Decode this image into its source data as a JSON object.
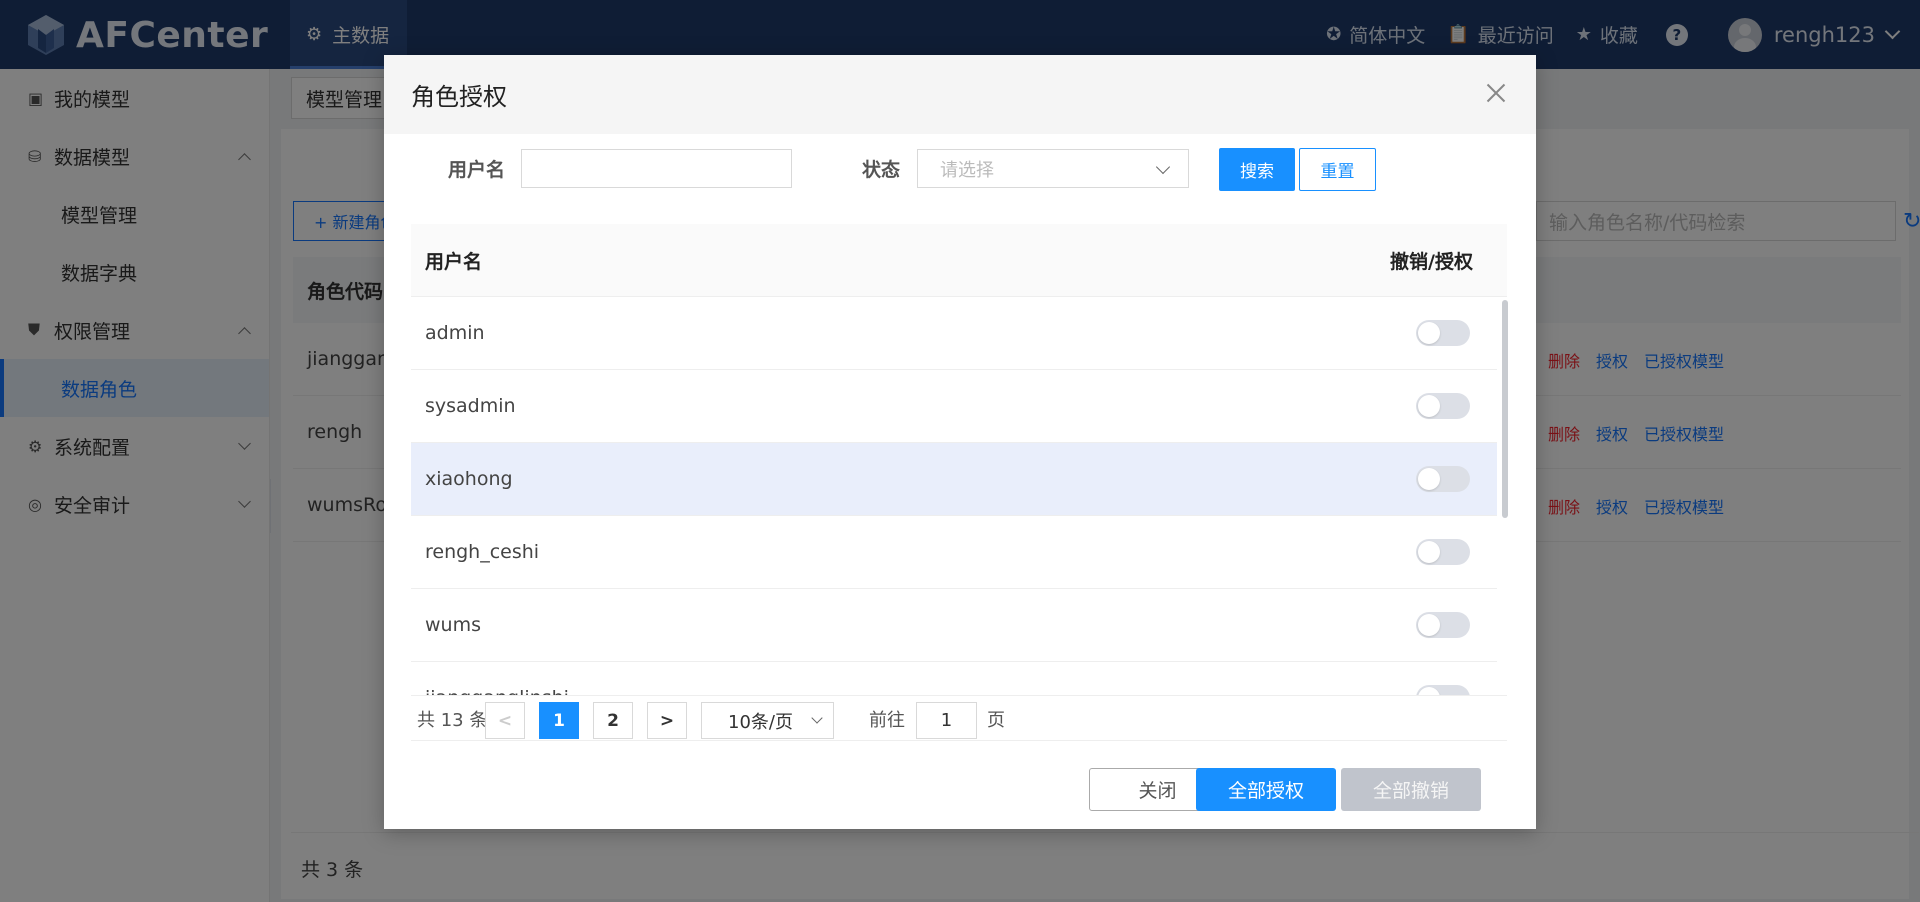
{
  "header": {
    "logo_text": "AFCenter",
    "nav_label": "主数据",
    "lang_label": "简体中文",
    "recent_label": "最近访问",
    "favorite_label": "收藏",
    "help_label": "?",
    "username": "rengh123"
  },
  "sidebar": {
    "items": [
      {
        "label": "我的模型"
      },
      {
        "label": "数据模型"
      },
      {
        "label": "模型管理"
      },
      {
        "label": "数据字典"
      },
      {
        "label": "权限管理"
      },
      {
        "label": "数据角色"
      },
      {
        "label": "系统配置"
      },
      {
        "label": "安全审计"
      }
    ]
  },
  "background": {
    "tab_label": "模型管理",
    "new_button": "+ 新建角色",
    "search_placeholder": "输入角色名称/代码检索",
    "column_role_code": "角色代码",
    "rows": [
      {
        "code": "jianggangl"
      },
      {
        "code": "rengh"
      },
      {
        "code": "wumsRole"
      }
    ],
    "actions": {
      "delete": "删除",
      "grant": "授权",
      "granted_models": "已授权模型"
    },
    "total": "共 3 条"
  },
  "modal": {
    "title": "角色授权",
    "filter": {
      "username_label": "用户名",
      "username_value": "",
      "status_label": "状态",
      "status_placeholder": "请选择",
      "search_button": "搜索",
      "reset_button": "重置"
    },
    "table": {
      "col_username": "用户名",
      "col_action": "撤销/授权",
      "rows": [
        {
          "username": "admin",
          "granted": false
        },
        {
          "username": "sysadmin",
          "granted": false
        },
        {
          "username": "xiaohong",
          "granted": false
        },
        {
          "username": "rengh_ceshi",
          "granted": false
        },
        {
          "username": "wums",
          "granted": false
        },
        {
          "username": "jiangganglinshi",
          "granted": false
        }
      ]
    },
    "pagination": {
      "total": "共 13 条",
      "prev": "<",
      "page1": "1",
      "page2": "2",
      "next": ">",
      "page_size": "10条/页",
      "goto_label": "前往",
      "goto_value": "1",
      "page_label": "页"
    },
    "footer": {
      "close": "关闭",
      "grant_all": "全部授权",
      "revoke_all": "全部撤销"
    }
  },
  "colors": {
    "header_bg": "#1f3a6a",
    "primary": "#1890ff",
    "active_menu_bg": "#e6f0fb",
    "highlight_row": "#e9eefb"
  }
}
